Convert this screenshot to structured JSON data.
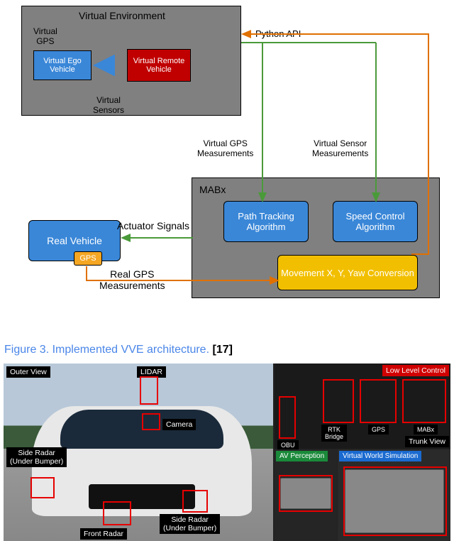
{
  "diagram": {
    "ve": {
      "title": "Virtual Environment",
      "vgps": "Virtual\nGPS",
      "vego": "Virtual Ego Vehicle",
      "vremote": "Virtual Remote Vehicle",
      "vsensors": "Virtual\nSensors"
    },
    "mabx": {
      "title": "MABx",
      "path": "Path Tracking Algorithm",
      "speed": "Speed Control Algorithm",
      "move": "Movement X, Y, Yaw Conversion"
    },
    "real": {
      "vehicle": "Real Vehicle",
      "gps": "GPS"
    },
    "labels": {
      "api": "Python API",
      "vgpsm": "Virtual GPS\nMeasurements",
      "vsensm": "Virtual Sensor\nMeasurements",
      "actsig": "Actuator Signals",
      "realgps": "Real GPS\nMeasurements"
    }
  },
  "caption": {
    "text": "Figure 3. Implemented VVE architecture.",
    "ref": "[17]"
  },
  "photo": {
    "left": {
      "outer_view": "Outer View",
      "lidar": "LIDAR",
      "camera": "Camera",
      "side_radar_top": "Side Radar\n(Under Bumper)",
      "side_radar_bot": "Side Radar\n(Under Bumper)",
      "front_radar": "Front Radar"
    },
    "right": {
      "trunk_view": "Trunk View",
      "low_level": "Low Level Control",
      "obu": "OBU",
      "rtk": "RTK\nBridge",
      "gps": "GPS",
      "mabx": "MABx",
      "av_perception": "AV Perception",
      "vws": "Virtual World Simulation"
    }
  }
}
